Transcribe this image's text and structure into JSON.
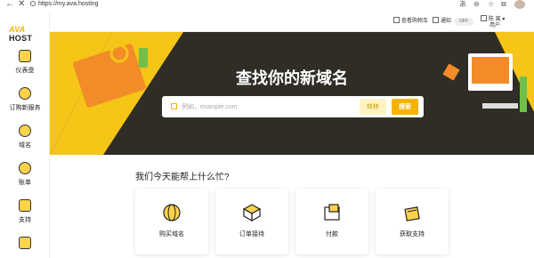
{
  "browser": {
    "url": "https://my.ava.hosting"
  },
  "logo": {
    "part1": "AVA",
    "part2": "HOST"
  },
  "sidebar": {
    "items": [
      {
        "label": "仪表盘"
      },
      {
        "label": "订购新服务"
      },
      {
        "label": "域名"
      },
      {
        "label": "账单"
      },
      {
        "label": "支持"
      }
    ]
  },
  "topbar": {
    "cart_label": "查看购物车",
    "notify_label": "通知",
    "toggle_label": "OFF",
    "user_name": "陈 离",
    "user_sub": "用户"
  },
  "hero": {
    "title": "查找你的新域名",
    "search_placeholder": "例如，example.com",
    "transfer_label": "转移",
    "search_button": "搜索"
  },
  "help": {
    "title": "我们今天能帮上什么忙?",
    "cards": [
      {
        "label": "购买域名"
      },
      {
        "label": "订单接待"
      },
      {
        "label": "付款"
      },
      {
        "label": "获取支持"
      }
    ]
  },
  "colors": {
    "accent": "#f5b301",
    "hero_bg": "#2f2d26"
  }
}
